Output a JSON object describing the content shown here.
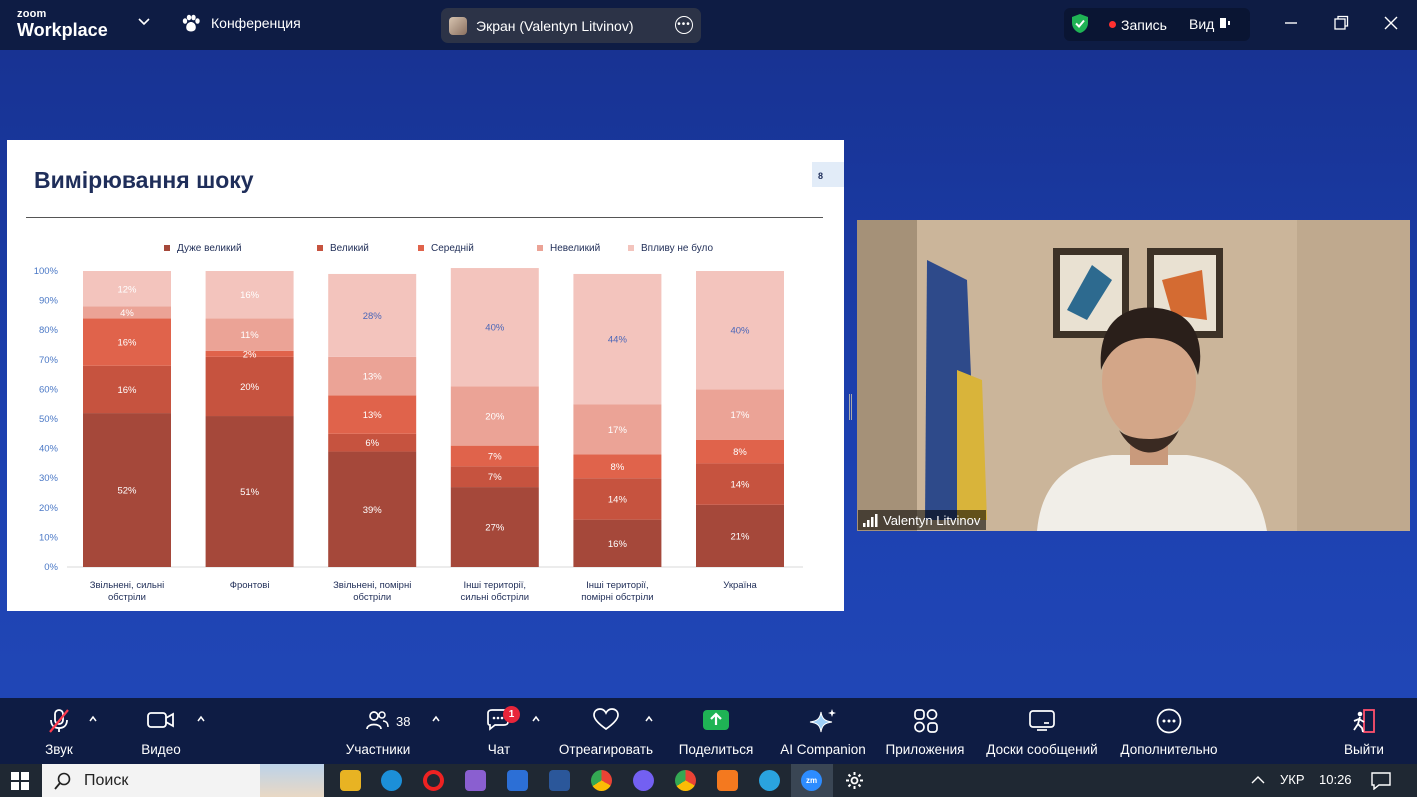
{
  "topbar": {
    "logo_top": "zoom",
    "logo_bottom": "Workplace",
    "meeting_label": "Конференция",
    "share_label": "Экран (Valentyn Litvinov)",
    "recording_label": "Запись",
    "view_label": "Вид"
  },
  "slide": {
    "title": "Вимірювання шоку",
    "page_number": "8"
  },
  "chart_data": {
    "type": "bar",
    "stacked": true,
    "categories": [
      [
        "Звільнені, сильні",
        "обстріли"
      ],
      [
        "Фронтові"
      ],
      [
        "Звільнені, помірні",
        "обстріли"
      ],
      [
        "Інші території,",
        "сильні обстріли"
      ],
      [
        "Інші території,",
        "помірні обстріли"
      ],
      [
        "Україна"
      ]
    ],
    "series": [
      {
        "name": "Дуже великий",
        "color": "#a5483a",
        "values": [
          52,
          51,
          39,
          27,
          16,
          21
        ],
        "labels": [
          "52%",
          "51%",
          "39%",
          "27%",
          "16%",
          "21%"
        ]
      },
      {
        "name": "Великий",
        "color": "#c6533f",
        "values": [
          16,
          20,
          6,
          7,
          14,
          14
        ],
        "labels": [
          "16%",
          "20%",
          "6%",
          "7%",
          "14%",
          "14%"
        ]
      },
      {
        "name": "Середній",
        "color": "#e0634b",
        "values": [
          16,
          2,
          13,
          7,
          8,
          8
        ],
        "labels": [
          "16%",
          "2%",
          "13%",
          "7%",
          "8%",
          "8%"
        ]
      },
      {
        "name": "Невеликий",
        "color": "#eba396",
        "values": [
          4,
          11,
          13,
          20,
          17,
          17
        ],
        "labels": [
          "4%",
          "11%",
          "13%",
          "20%",
          "17%",
          "17%"
        ]
      },
      {
        "name": "Впливу не було",
        "color": "#f3c4bd",
        "values": [
          12,
          16,
          28,
          40,
          44,
          40
        ],
        "labels": [
          "12%",
          "16%",
          "28%",
          "40%",
          "44%",
          "40%"
        ]
      }
    ],
    "y_ticks": [
      "0%",
      "10%",
      "20%",
      "30%",
      "40%",
      "50%",
      "60%",
      "70%",
      "80%",
      "90%",
      "100%"
    ],
    "ylim": [
      0,
      100
    ],
    "legend_position": "top",
    "grid": false
  },
  "video": {
    "participant_name": "Valentyn Litvinov"
  },
  "toolbar": {
    "audio": "Звук",
    "video": "Видео",
    "participants": "Участники",
    "participants_count": "38",
    "chat": "Чат",
    "chat_badge": "1",
    "react": "Отреагировать",
    "share": "Поделиться",
    "ai": "AI Companion",
    "apps": "Приложения",
    "whiteboards": "Доски сообщений",
    "more": "Дополнительно",
    "leave": "Выйти"
  },
  "taskbar": {
    "search": "Поиск",
    "language": "УКР",
    "time": "10:26"
  },
  "colors": {
    "accent_green": "#1fb355",
    "record_red": "#ff3030",
    "leave_pink": "#ff4f6d"
  }
}
